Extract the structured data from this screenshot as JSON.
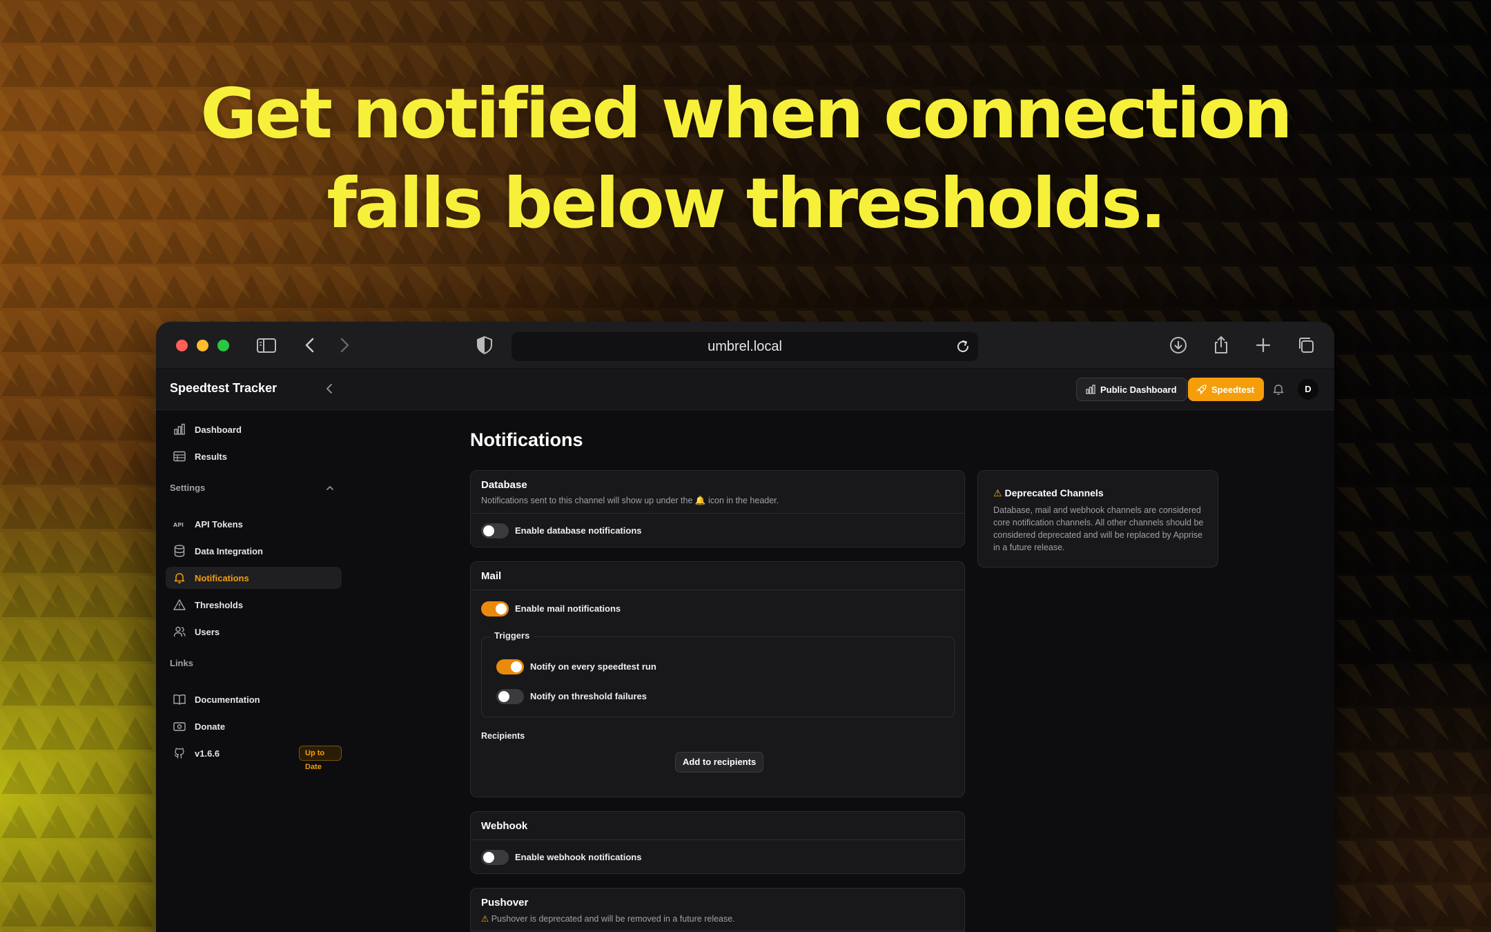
{
  "headline": {
    "line1": "Get notified when connection",
    "line2": "falls below thresholds."
  },
  "browser": {
    "url": "umbrel.local",
    "icons": [
      "sidebar-icon",
      "back-icon",
      "forward-icon",
      "shield-icon",
      "reload-icon",
      "download-icon",
      "share-icon",
      "new-tab-icon",
      "tabs-icon"
    ]
  },
  "app": {
    "brand": "Speedtest Tracker",
    "public_dashboard": "Public Dashboard",
    "speedtest": "Speedtest",
    "avatar_initial": "D",
    "accent": "#f59e0b"
  },
  "sidebar": {
    "items": [
      {
        "label": "Dashboard",
        "icon": "bar-chart-icon"
      },
      {
        "label": "Results",
        "icon": "table-icon"
      }
    ],
    "settings_label": "Settings",
    "settings_items": [
      {
        "label": "API Tokens",
        "icon": "api-icon"
      },
      {
        "label": "Data Integration",
        "icon": "database-icon"
      },
      {
        "label": "Notifications",
        "icon": "bell-icon",
        "active": true
      },
      {
        "label": "Thresholds",
        "icon": "warning-icon"
      },
      {
        "label": "Users",
        "icon": "users-icon"
      }
    ],
    "links_label": "Links",
    "link_items": [
      {
        "label": "Documentation",
        "icon": "book-icon"
      },
      {
        "label": "Donate",
        "icon": "money-icon"
      },
      {
        "label": "v1.6.6",
        "icon": "github-icon"
      }
    ],
    "version_badge": "Up to Date"
  },
  "main": {
    "title": "Notifications",
    "database": {
      "title": "Database",
      "subtitle_pre": "Notifications sent to this channel will show up under the",
      "subtitle_post": "icon in the header.",
      "toggle_label": "Enable database notifications",
      "enabled": false
    },
    "mail": {
      "title": "Mail",
      "toggle_label": "Enable mail notifications",
      "enabled": true,
      "triggers_label": "Triggers",
      "trigger_every": "Notify on every speedtest run",
      "trigger_every_on": true,
      "trigger_threshold": "Notify on threshold failures",
      "trigger_threshold_on": false,
      "recipients_label": "Recipients",
      "add_recipients": "Add to recipients"
    },
    "webhook": {
      "title": "Webhook",
      "toggle_label": "Enable webhook notifications",
      "enabled": false
    },
    "pushover": {
      "title": "Pushover",
      "warning": "Pushover is deprecated and will be removed in a future release."
    },
    "deprecated": {
      "title": "Deprecated Channels",
      "body": "Database, mail and webhook channels are considered core notification channels. All other channels should be considered deprecated and will be replaced by Apprise in a future release."
    }
  }
}
